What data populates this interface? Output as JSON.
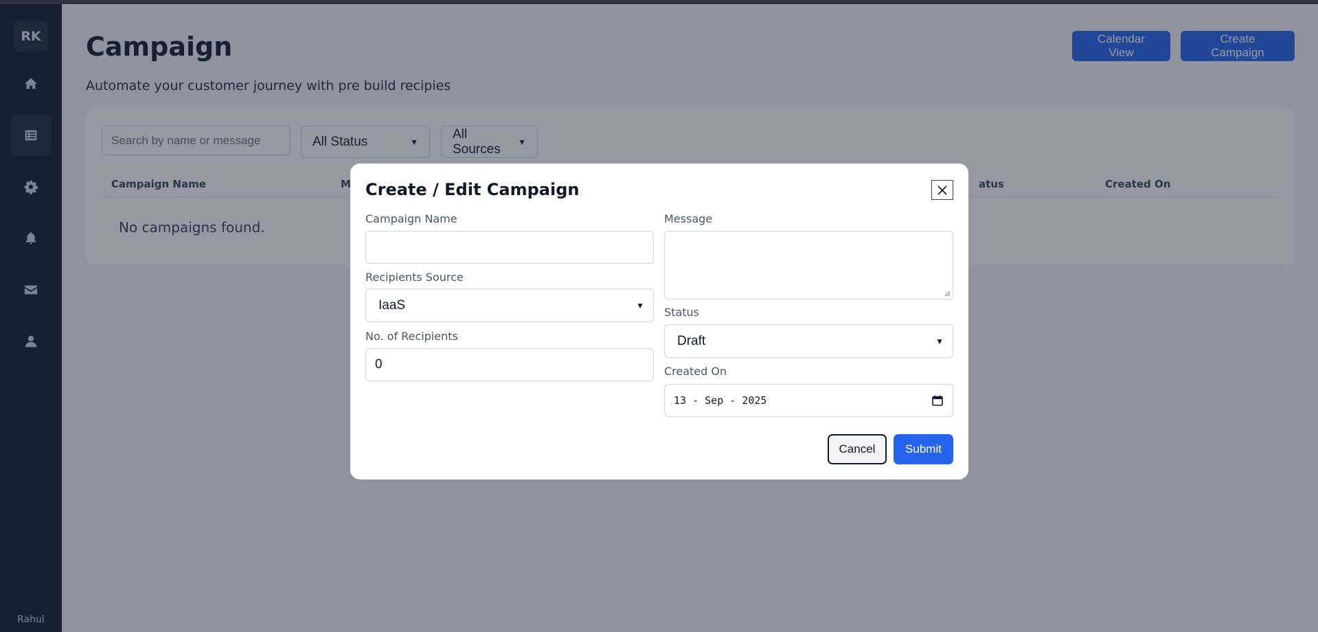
{
  "sidebar": {
    "avatar_initials": "RK",
    "items": [
      {
        "icon": "home-icon"
      },
      {
        "icon": "list-icon",
        "active": true
      },
      {
        "icon": "gear-icon"
      },
      {
        "icon": "bell-icon"
      },
      {
        "icon": "mail-icon"
      },
      {
        "icon": "user-icon"
      }
    ],
    "username": "Rahul"
  },
  "header": {
    "title": "Campaign",
    "subtitle": "Automate your customer journey with pre build recipies",
    "calendar_view_label": "Calendar View",
    "create_campaign_label": "Create Campaign"
  },
  "filters": {
    "search_placeholder": "Search by name or message",
    "status_value": "All Status",
    "sources_value": "All Sources"
  },
  "table": {
    "columns": [
      "Campaign Name",
      "M",
      "atus",
      "Created On"
    ],
    "empty_message": "No campaigns found."
  },
  "modal": {
    "title": "Create / Edit Campaign",
    "fields": {
      "campaign_name_label": "Campaign Name",
      "campaign_name_value": "",
      "recipients_source_label": "Recipients Source",
      "recipients_source_value": "IaaS",
      "recipients_count_label": "No. of Recipients",
      "recipients_count_value": "0",
      "message_label": "Message",
      "message_value": "",
      "status_label": "Status",
      "status_value": "Draft",
      "created_on_label": "Created On",
      "created_on_value": "13 - Sep - 2025"
    },
    "cancel_label": "Cancel",
    "submit_label": "Submit"
  },
  "colors": {
    "sidebar_bg": "#0f172a",
    "primary": "#2563eb",
    "overlay": "rgba(31, 41, 60, 0.48)"
  }
}
